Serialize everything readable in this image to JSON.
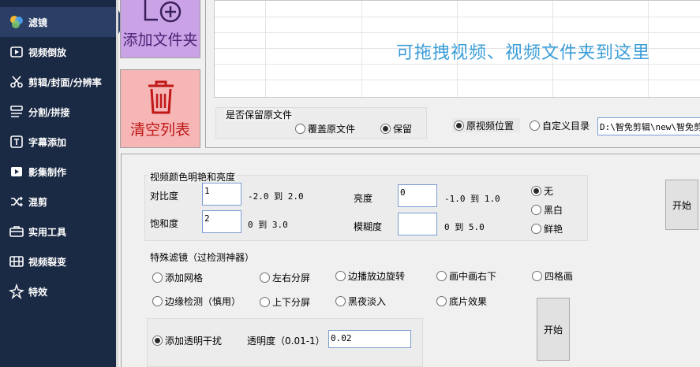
{
  "sidebar": {
    "items": [
      {
        "label": "滤镜",
        "icon": "filter-icon"
      },
      {
        "label": "视频倒放",
        "icon": "play-reverse-icon"
      },
      {
        "label": "剪辑/封面/分辨率",
        "icon": "scissors-icon"
      },
      {
        "label": "分割/拼接",
        "icon": "split-icon"
      },
      {
        "label": "字幕添加",
        "icon": "subtitle-icon"
      },
      {
        "label": "影集制作",
        "icon": "album-icon"
      },
      {
        "label": "混剪",
        "icon": "shuffle-icon"
      },
      {
        "label": "实用工具",
        "icon": "toolbox-icon"
      },
      {
        "label": "视频裂变",
        "icon": "split-video-icon"
      },
      {
        "label": "特效",
        "icon": "sparkle-icon"
      }
    ]
  },
  "actions": {
    "add_folder": "添加文件夹",
    "clear_list": "清空列表"
  },
  "dropzone": {
    "hint": "可拖拽视频、视频文件夹到这里"
  },
  "keep_original": {
    "title": "是否保留原文件",
    "overwrite": "覆盖原文件",
    "keep": "保留"
  },
  "output": {
    "original_location": "原视频位置",
    "custom_dir": "自定义目录",
    "path": "D:\\智免剪辑\\new\\智免剪"
  },
  "color_adjust": {
    "title": "视频颜色明艳和亮度",
    "contrast_label": "对比度",
    "contrast_value": "1",
    "contrast_range": "-2.0 到 2.0",
    "brightness_label": "亮度",
    "brightness_value": "0",
    "brightness_range": "-1.0 到 1.0",
    "saturation_label": "饱和度",
    "saturation_value": "2",
    "saturation_range": "0 到 3.0",
    "blur_label": "模糊度",
    "blur_value": "",
    "blur_range": "0 到 5.0",
    "mode_none": "无",
    "mode_bw": "黑白",
    "mode_vivid": "鲜艳",
    "start": "开始"
  },
  "special_filters": {
    "title": "特殊滤镜（过检测神器）",
    "grid": "添加网格",
    "lr_split": "左右分屏",
    "rotate": "边播放边旋转",
    "pip": "画中画右下",
    "four_grid": "四格画",
    "edge": "边缘检测（慎用）",
    "ud_split": "上下分屏",
    "night_fade": "黑夜淡入",
    "negative": "底片效果",
    "transparent": "添加透明干扰",
    "opacity_label": "透明度（0.01-1）",
    "opacity_value": "0.02",
    "start": "开始"
  }
}
